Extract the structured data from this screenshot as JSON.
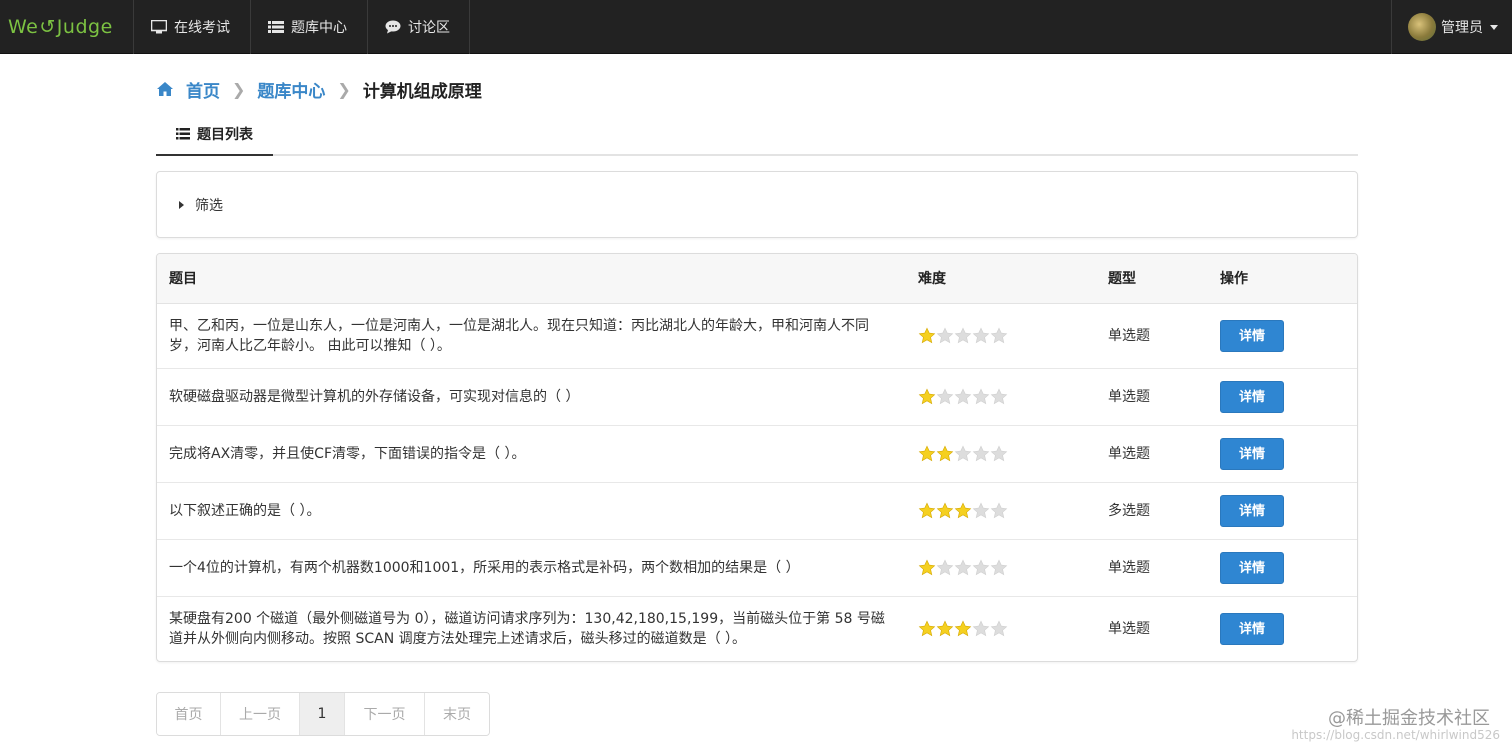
{
  "nav": {
    "logo": "WeJudge",
    "logo_left": "We",
    "logo_right": "Judge",
    "items": [
      {
        "label": "在线考试",
        "icon": "monitor-icon"
      },
      {
        "label": "题库中心",
        "icon": "list-icon"
      },
      {
        "label": "讨论区",
        "icon": "chat-bubble-icon"
      }
    ],
    "user": "管理员"
  },
  "breadcrumb": {
    "home": "首页",
    "middle": "题库中心",
    "current": "计算机组成原理"
  },
  "tab": {
    "label": "题目列表"
  },
  "filter": {
    "label": "筛选"
  },
  "table": {
    "headers": {
      "title": "题目",
      "difficulty": "难度",
      "type": "题型",
      "action": "操作"
    },
    "rows": [
      {
        "title": "甲、乙和丙，一位是山东人，一位是河南人，一位是湖北人。现在只知道：丙比湖北人的年龄大，甲和河南人不同岁，河南人比乙年龄小。 由此可以推知（ ）。",
        "difficulty": 1,
        "type": "单选题",
        "action": "详情"
      },
      {
        "title": "软硬磁盘驱动器是微型计算机的外存储设备，可实现对信息的（ ）",
        "difficulty": 1,
        "type": "单选题",
        "action": "详情"
      },
      {
        "title": "完成将AX清零，并且使CF清零，下面错误的指令是（ ）。",
        "difficulty": 2,
        "type": "单选题",
        "action": "详情"
      },
      {
        "title": "以下叙述正确的是（ ）。",
        "difficulty": 3,
        "type": "多选题",
        "action": "详情"
      },
      {
        "title": "一个4位的计算机，有两个机器数1000和1001，所采用的表示格式是补码，两个数相加的结果是（ ）",
        "difficulty": 1,
        "type": "单选题",
        "action": "详情"
      },
      {
        "title": "某硬盘有200 个磁道（最外侧磁道号为 0），磁道访问请求序列为：130,42,180,15,199，当前磁头位于第 58 号磁道并从外侧向内侧移动。按照 SCAN 调度方法处理完上述请求后，磁头移过的磁道数是（ ）。",
        "difficulty": 3,
        "type": "单选题",
        "action": "详情"
      }
    ]
  },
  "pagination": {
    "first": "首页",
    "prev": "上一页",
    "current": "1",
    "next": "下一页",
    "last": "末页"
  },
  "watermark": "@稀土掘金技术社区",
  "watermark_url": "https://blog.csdn.net/whirlwind526",
  "colors": {
    "topbar": "#222222",
    "logo_green": "#7cc242",
    "link_blue": "#3a87c8",
    "button_blue": "#2f86d2",
    "star_filled": "#f5d020",
    "star_empty": "#dddddd"
  }
}
